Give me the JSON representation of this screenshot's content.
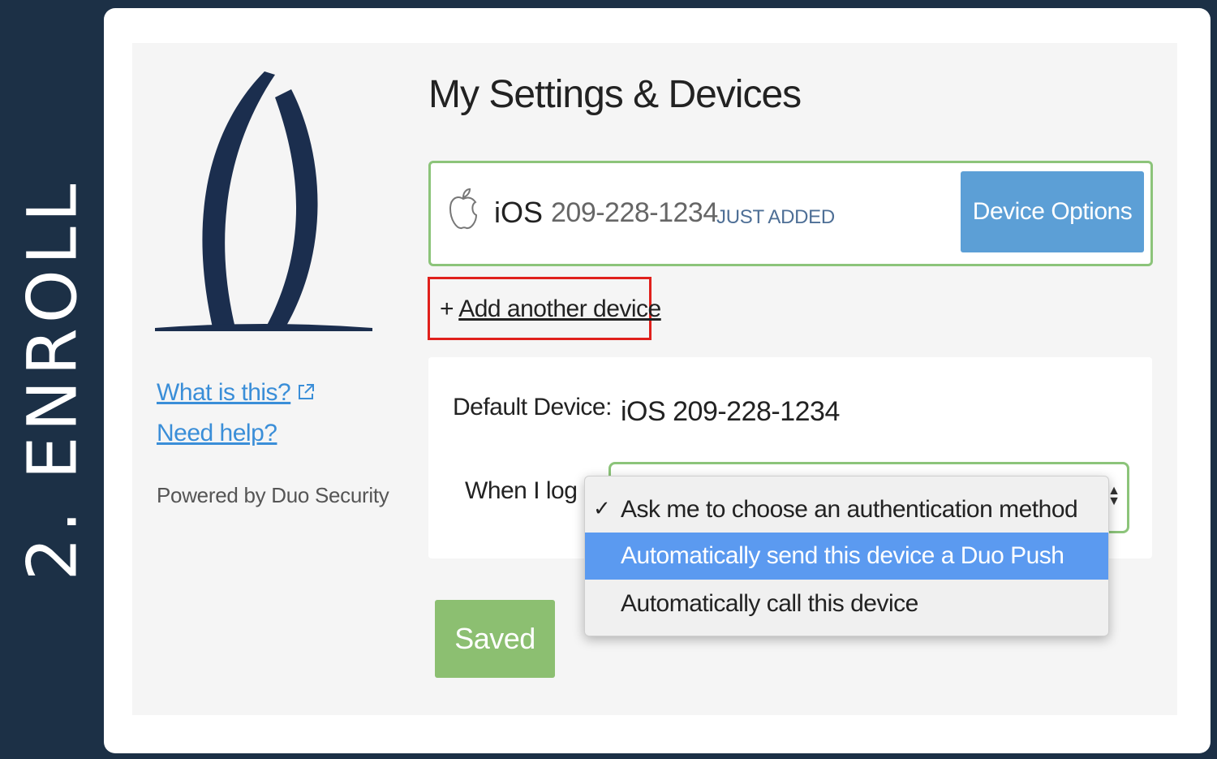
{
  "side_label": "2. ENROLL",
  "colors": {
    "frame": "#1c3046",
    "accent_blue": "#5c9fd6",
    "success_green": "#8cc47a",
    "highlight_red": "#e0201c",
    "dropdown_highlight": "#5b9af0"
  },
  "sidebar": {
    "links": [
      "What is this?",
      "Need help?"
    ],
    "what_is_this_icon": "external-link-icon",
    "powered_by": "Powered by Duo Security"
  },
  "main": {
    "title": "My Settings & Devices",
    "device": {
      "icon": "apple-icon",
      "os": "iOS",
      "phone": "209-228-1234",
      "badge": "JUST ADDED",
      "options_label": "Device Options"
    },
    "add_device": {
      "prefix": "+",
      "label": "Add another device"
    },
    "settings": {
      "default_device_label": "Default Device:",
      "default_device_value": "iOS 209-228-1234",
      "when_login_label": "When I log in:"
    },
    "saved_label": "Saved",
    "dropdown": {
      "options": [
        "Ask me to choose an authentication method",
        "Automatically send this device a Duo Push",
        "Automatically call this device"
      ],
      "checked": "Ask me to choose an authentication method",
      "highlighted": "Automatically send this device a Duo Push"
    }
  }
}
